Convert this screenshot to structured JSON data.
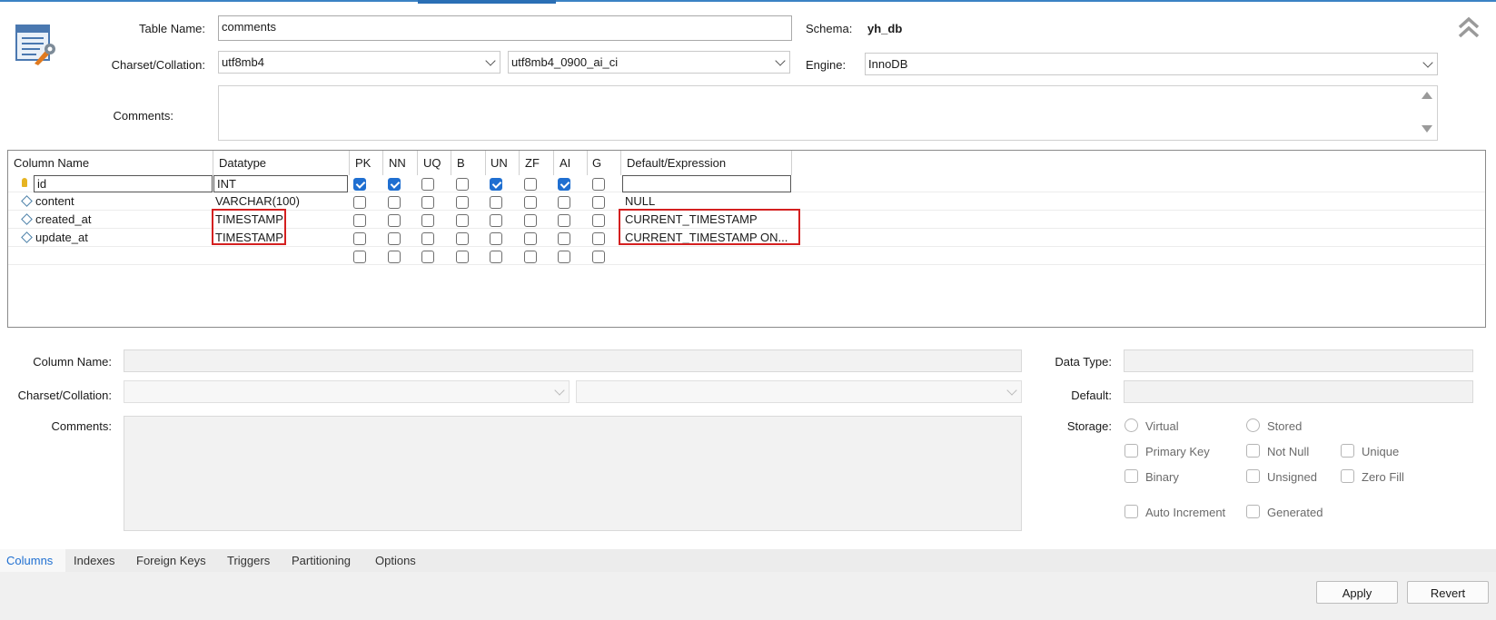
{
  "header": {
    "table_name_label": "Table Name:",
    "table_name_value": "comments",
    "schema_label": "Schema:",
    "schema_value": "yh_db",
    "charset_label": "Charset/Collation:",
    "charset_value": "utf8mb4",
    "collation_value": "utf8mb4_0900_ai_ci",
    "engine_label": "Engine:",
    "engine_value": "InnoDB",
    "comments_label": "Comments:",
    "comments_value": ""
  },
  "grid": {
    "headers": [
      "Column Name",
      "Datatype",
      "PK",
      "NN",
      "UQ",
      "B",
      "UN",
      "ZF",
      "AI",
      "G",
      "Default/Expression"
    ],
    "rows": [
      {
        "name": "id",
        "datatype": "INT",
        "default": "",
        "flags": [
          true,
          true,
          false,
          false,
          true,
          false,
          true,
          false
        ],
        "primary_key": true
      },
      {
        "name": "content",
        "datatype": "VARCHAR(100)",
        "default": "NULL",
        "flags": [
          false,
          false,
          false,
          false,
          false,
          false,
          false,
          false
        ],
        "primary_key": false
      },
      {
        "name": "created_at",
        "datatype": "TIMESTAMP",
        "default": "CURRENT_TIMESTAMP",
        "flags": [
          false,
          false,
          false,
          false,
          false,
          false,
          false,
          false
        ],
        "primary_key": false
      },
      {
        "name": "update_at",
        "datatype": "TIMESTAMP",
        "default": "CURRENT_TIMESTAMP ON...",
        "flags": [
          false,
          false,
          false,
          false,
          false,
          false,
          false,
          false
        ],
        "primary_key": false
      },
      {
        "name": "",
        "datatype": "",
        "default": "",
        "flags": [
          false,
          false,
          false,
          false,
          false,
          false,
          false,
          false
        ],
        "primary_key": false
      }
    ]
  },
  "details": {
    "column_name_label": "Column Name:",
    "charset_label": "Charset/Collation:",
    "comments_label": "Comments:",
    "data_type_label": "Data Type:",
    "default_label": "Default:",
    "storage_label": "Storage:",
    "virtual_label": "Virtual",
    "stored_label": "Stored",
    "primary_key_label": "Primary Key",
    "not_null_label": "Not Null",
    "unique_label": "Unique",
    "binary_label": "Binary",
    "unsigned_label": "Unsigned",
    "zero_fill_label": "Zero Fill",
    "auto_increment_label": "Auto Increment",
    "generated_label": "Generated"
  },
  "tabs": [
    "Columns",
    "Indexes",
    "Foreign Keys",
    "Triggers",
    "Partitioning",
    "Options"
  ],
  "active_tab": "Columns",
  "buttons": {
    "apply": "Apply",
    "revert": "Revert"
  },
  "icons": {
    "table_icon": "table-wrench-icon",
    "collapse": "double-chevron-up-icon"
  },
  "colors": {
    "accent": "#1f6fd1",
    "highlight": "#d42020"
  }
}
